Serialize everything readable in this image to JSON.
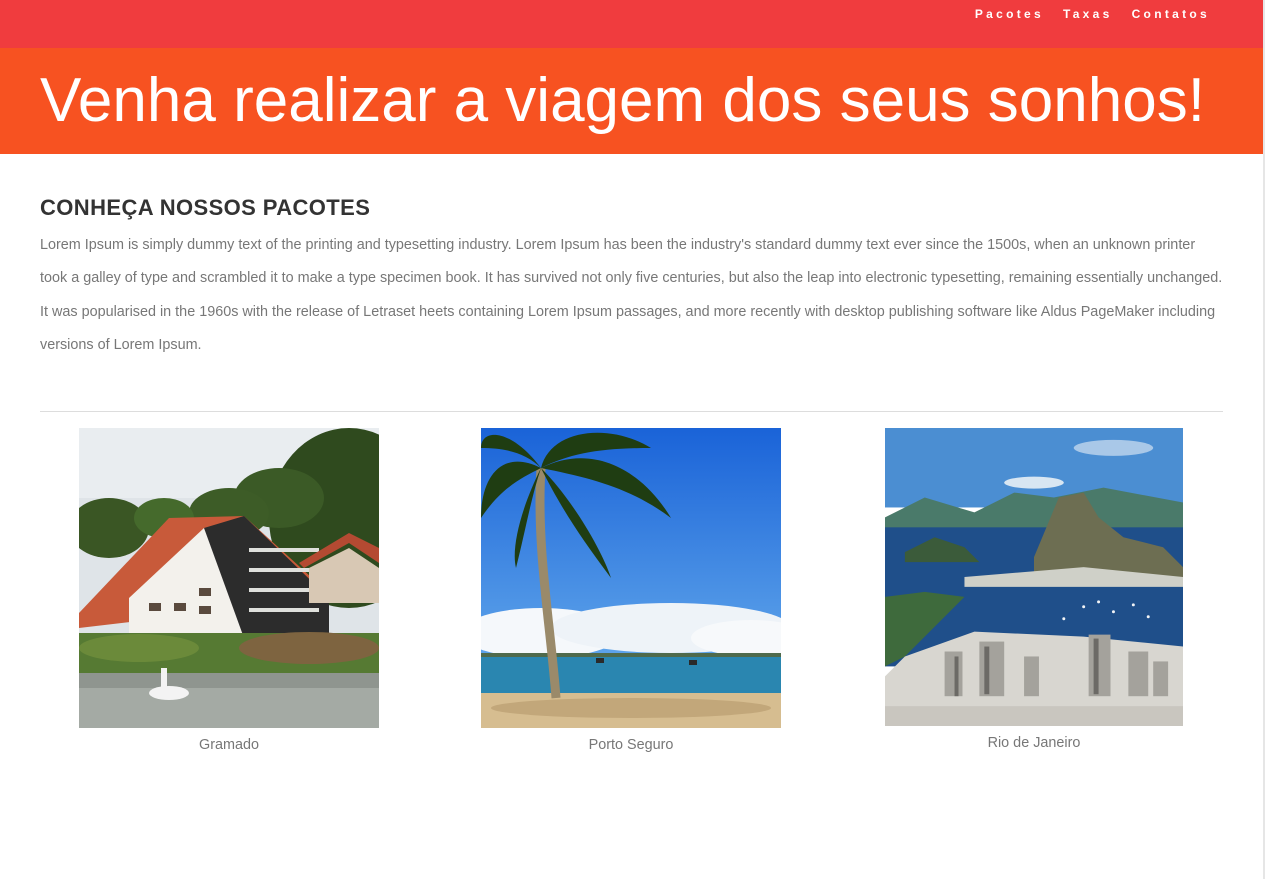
{
  "nav": {
    "items": [
      {
        "label": "Pacotes"
      },
      {
        "label": "Taxas"
      },
      {
        "label": "Contatos"
      }
    ]
  },
  "banner": {
    "title": "Venha realizar a viagem dos seus sonhos!"
  },
  "main": {
    "heading": "CONHEÇA NOSSOS PACOTES",
    "paragraph": "Lorem Ipsum is simply dummy text of the printing and typesetting industry. Lorem Ipsum has been the industry's standard dummy text ever since the 1500s, when an unknown printer took a galley of type and scrambled it to make a type specimen book. It has survived not only five centuries, but also the leap into electronic typesetting, remaining essentially unchanged. It was popularised in the 1960s with the release of Letraset heets containing Lorem Ipsum passages, and more recently with desktop publishing software like Aldus PageMaker including versions of Lorem Ipsum."
  },
  "packages": [
    {
      "caption": "Gramado",
      "image": "hotel-by-lake-photo"
    },
    {
      "caption": "Porto Seguro",
      "image": "palm-tree-beach-photo"
    },
    {
      "caption": "Rio de Janeiro",
      "image": "rio-bay-aerial-photo"
    }
  ],
  "colors": {
    "nav_bg": "#f03c3e",
    "banner_bg": "#f75221",
    "text_muted": "#777777",
    "heading": "#333333"
  }
}
